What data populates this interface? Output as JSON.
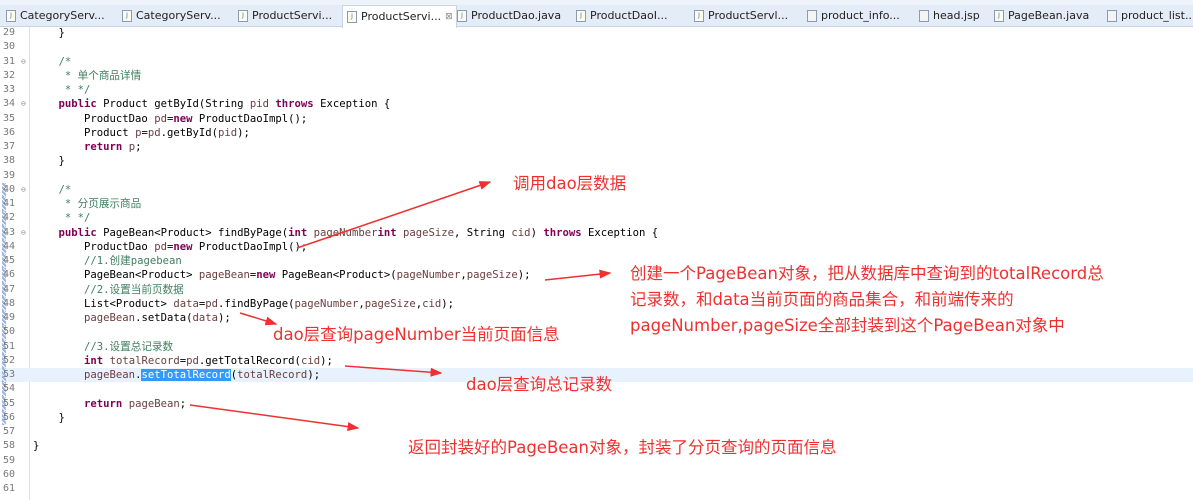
{
  "tabs": [
    {
      "label": "CategoryServ...",
      "icon": "java-file-icon",
      "active": false
    },
    {
      "label": "CategoryServ...",
      "icon": "java-file-icon",
      "active": false
    },
    {
      "label": "ProductServi...",
      "icon": "java-file-icon",
      "active": false
    },
    {
      "label": "ProductServi...",
      "icon": "java-file-icon",
      "active": true
    },
    {
      "label": "ProductDao.java",
      "icon": "java-interface-icon",
      "active": false
    },
    {
      "label": "ProductDaoI...",
      "icon": "java-file-icon",
      "active": false
    },
    {
      "label": "ProductServl...",
      "icon": "java-file-icon",
      "active": false
    },
    {
      "label": "product_info...",
      "icon": "jsp-file-icon",
      "active": false
    },
    {
      "label": "head.jsp",
      "icon": "jsp-file-icon",
      "active": false
    },
    {
      "label": "PageBean.java",
      "icon": "java-interface-icon",
      "active": false
    },
    {
      "label": "product_list...",
      "icon": "jsp-file-icon",
      "active": false
    }
  ],
  "close_glyph": "⊠",
  "code_lines": [
    {
      "n": "29",
      "seg": [
        [
          "",
          "    }"
        ]
      ]
    },
    {
      "n": "30",
      "seg": []
    },
    {
      "n": "31",
      "fold": true,
      "seg": [
        [
          "cm",
          "    /*"
        ]
      ]
    },
    {
      "n": "32",
      "seg": [
        [
          "cm",
          "     * 单个商品详情"
        ]
      ]
    },
    {
      "n": "33",
      "seg": [
        [
          "cm",
          "     * */"
        ]
      ]
    },
    {
      "n": "34",
      "fold": true,
      "override": true,
      "seg": [
        [
          "",
          "    "
        ],
        [
          "kw",
          "public"
        ],
        [
          "",
          " Product getById(String "
        ],
        [
          "var",
          "pid"
        ],
        [
          "",
          " "
        ],
        [
          "kw",
          "throws"
        ],
        [
          "",
          " Exception {"
        ]
      ]
    },
    {
      "n": "35",
      "seg": [
        [
          "",
          "        ProductDao "
        ],
        [
          "var",
          "pd"
        ],
        [
          "",
          "="
        ],
        [
          "kw",
          "new"
        ],
        [
          "",
          " ProductDaoImpl();"
        ]
      ]
    },
    {
      "n": "36",
      "seg": [
        [
          "",
          "        Product "
        ],
        [
          "var",
          "p"
        ],
        [
          "",
          "="
        ],
        [
          "var",
          "pd"
        ],
        [
          "",
          ".getById("
        ],
        [
          "var",
          "pid"
        ],
        [
          "",
          ");"
        ]
      ]
    },
    {
      "n": "37",
      "seg": [
        [
          "",
          "        "
        ],
        [
          "kw",
          "return"
        ],
        [
          "",
          " "
        ],
        [
          "var",
          "p"
        ],
        [
          "",
          ";"
        ]
      ]
    },
    {
      "n": "38",
      "seg": [
        [
          "",
          "    }"
        ]
      ]
    },
    {
      "n": "39",
      "seg": []
    },
    {
      "n": "40",
      "fold": true,
      "mark": true,
      "seg": [
        [
          "cm",
          "    /*"
        ]
      ]
    },
    {
      "n": "41",
      "mark": true,
      "seg": [
        [
          "cm",
          "     * 分页展示商品"
        ]
      ]
    },
    {
      "n": "42",
      "mark": true,
      "seg": [
        [
          "cm",
          "     * */"
        ]
      ]
    },
    {
      "n": "43",
      "fold": true,
      "mark": true,
      "override": true,
      "seg": [
        [
          "",
          "    "
        ],
        [
          "kw",
          "public"
        ],
        [
          "",
          " PageBean<Product> findByPage("
        ],
        [
          "kw",
          "int"
        ],
        [
          "",
          " "
        ],
        [
          "var",
          "pageNumber"
        ],
        [
          ", "
        ],
        [
          "kw",
          "int"
        ],
        [
          "",
          " "
        ],
        [
          "var",
          "pageSize"
        ],
        [
          "",
          ", String "
        ],
        [
          "var",
          "cid"
        ],
        [
          "",
          ") "
        ],
        [
          "kw",
          "throws"
        ],
        [
          "",
          " Exception {"
        ]
      ]
    },
    {
      "n": "44",
      "mark": true,
      "seg": [
        [
          "",
          "        ProductDao "
        ],
        [
          "var",
          "pd"
        ],
        [
          "",
          "="
        ],
        [
          "kw",
          "new"
        ],
        [
          "",
          " ProductDaoImpl();"
        ]
      ]
    },
    {
      "n": "45",
      "mark": true,
      "seg": [
        [
          "cm",
          "        //1.创建pagebean"
        ]
      ]
    },
    {
      "n": "46",
      "mark": true,
      "seg": [
        [
          "",
          "        PageBean<Product> "
        ],
        [
          "var",
          "pageBean"
        ],
        [
          "",
          "="
        ],
        [
          "kw",
          "new"
        ],
        [
          "",
          " PageBean<Product>("
        ],
        [
          "var",
          "pageNumber"
        ],
        [
          "",
          ","
        ],
        [
          "var",
          "pageSize"
        ],
        [
          "",
          ");"
        ]
      ]
    },
    {
      "n": "47",
      "mark": true,
      "seg": [
        [
          "cm",
          "        //2.设置当前页数据"
        ]
      ]
    },
    {
      "n": "48",
      "mark": true,
      "seg": [
        [
          "",
          "        List<Product> "
        ],
        [
          "var",
          "data"
        ],
        [
          "",
          "="
        ],
        [
          "var",
          "pd"
        ],
        [
          "",
          ".findByPage("
        ],
        [
          "var",
          "pageNumber"
        ],
        [
          "",
          ","
        ],
        [
          "var",
          "pageSize"
        ],
        [
          "",
          ","
        ],
        [
          "var",
          "cid"
        ],
        [
          "",
          ");"
        ]
      ]
    },
    {
      "n": "49",
      "mark": true,
      "seg": [
        [
          "",
          "        "
        ],
        [
          "var",
          "pageBean"
        ],
        [
          "",
          ".setData("
        ],
        [
          "var",
          "data"
        ],
        [
          "",
          ");"
        ]
      ]
    },
    {
      "n": "50",
      "mark": true,
      "seg": []
    },
    {
      "n": "51",
      "mark": true,
      "seg": [
        [
          "cm",
          "        //3.设置总记录数"
        ]
      ]
    },
    {
      "n": "52",
      "mark": true,
      "seg": [
        [
          "",
          "        "
        ],
        [
          "kw",
          "int"
        ],
        [
          "",
          " "
        ],
        [
          "var",
          "totalRecord"
        ],
        [
          "",
          "="
        ],
        [
          "var",
          "pd"
        ],
        [
          "",
          ".getTotalRecord("
        ],
        [
          "var",
          "cid"
        ],
        [
          "",
          ");"
        ]
      ]
    },
    {
      "n": "53",
      "mark": true,
      "current": true,
      "seg": [
        [
          "",
          "        "
        ],
        [
          "var",
          "pageBean"
        ],
        [
          "",
          "."
        ],
        [
          "sel",
          "setTotalRecord"
        ],
        [
          "",
          "("
        ],
        [
          "var",
          "totalRecord"
        ],
        [
          "",
          ");"
        ]
      ]
    },
    {
      "n": "54",
      "mark": true,
      "seg": []
    },
    {
      "n": "55",
      "mark": true,
      "seg": [
        [
          "",
          "        "
        ],
        [
          "kw",
          "return"
        ],
        [
          "",
          " "
        ],
        [
          "var",
          "pageBean"
        ],
        [
          "",
          ";"
        ]
      ]
    },
    {
      "n": "56",
      "mark": true,
      "seg": [
        [
          "",
          "    }"
        ]
      ]
    },
    {
      "n": "57",
      "seg": []
    },
    {
      "n": "58",
      "seg": [
        [
          "",
          "}"
        ]
      ]
    },
    {
      "n": "59",
      "seg": []
    },
    {
      "n": "60",
      "seg": []
    },
    {
      "n": "61",
      "seg": []
    }
  ],
  "annotations": {
    "call_dao": "调用dao层数据",
    "create_pagebean_1": "创建一个PageBean对象，把从数据库中查询到的totalRecord总",
    "create_pagebean_2": "记录数，和data当前页面的商品集合，和前端传来的",
    "create_pagebean_3": "pageNumber,pageSize全部封装到这个PageBean对象中",
    "query_page": "dao层查询pageNumber当前页面信息",
    "query_total": "dao层查询总记录数",
    "return_bean": "返回封装好的PageBean对象，封装了分页查询的页面信息"
  },
  "colors": {
    "annotation": "#f03030",
    "keyword": "#7f0055",
    "comment": "#3f7f5f",
    "variable": "#6a3e3e",
    "selection": "#3399ff",
    "current_line": "#e8f2fe"
  }
}
